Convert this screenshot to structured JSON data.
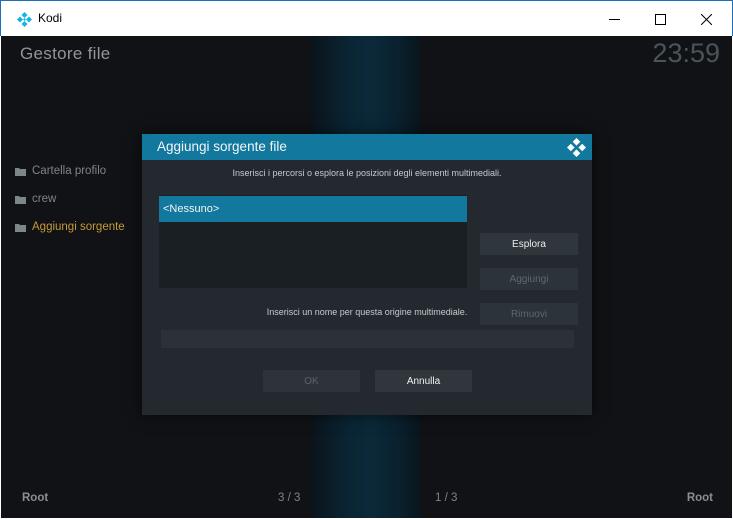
{
  "window": {
    "title": "Kodi",
    "icons": {
      "app": "kodi-logo-icon",
      "minimize": "minimize-icon",
      "maximize": "maximize-icon",
      "close": "close-icon"
    }
  },
  "header": {
    "title": "Gestore file",
    "clock": "23:59"
  },
  "sidebar": {
    "items": [
      {
        "label": "Cartella profilo",
        "active": false
      },
      {
        "label": "crew",
        "active": false
      },
      {
        "label": "Aggiungi sorgente",
        "active": true
      }
    ]
  },
  "footer": {
    "left": "Root",
    "center_left": "3 / 3",
    "center_right": "1 / 3",
    "right": "Root"
  },
  "dialog": {
    "title": "Aggiungi sorgente file",
    "hint_paths": "Inserisci i percorsi o esplora le posizioni degli elementi multimediali.",
    "paths": [
      "<Nessuno>"
    ],
    "buttons": {
      "browse": "Esplora",
      "add": "Aggiungi",
      "remove": "Rimuovi",
      "ok": "OK",
      "cancel": "Annulla"
    },
    "hint_name": "Inserisci un nome per questa origine multimediale.",
    "name_value": ""
  },
  "colors": {
    "accent": "#12789e",
    "active_item": "#c59a3a",
    "background": "#141619",
    "dialog": "#23292e"
  }
}
